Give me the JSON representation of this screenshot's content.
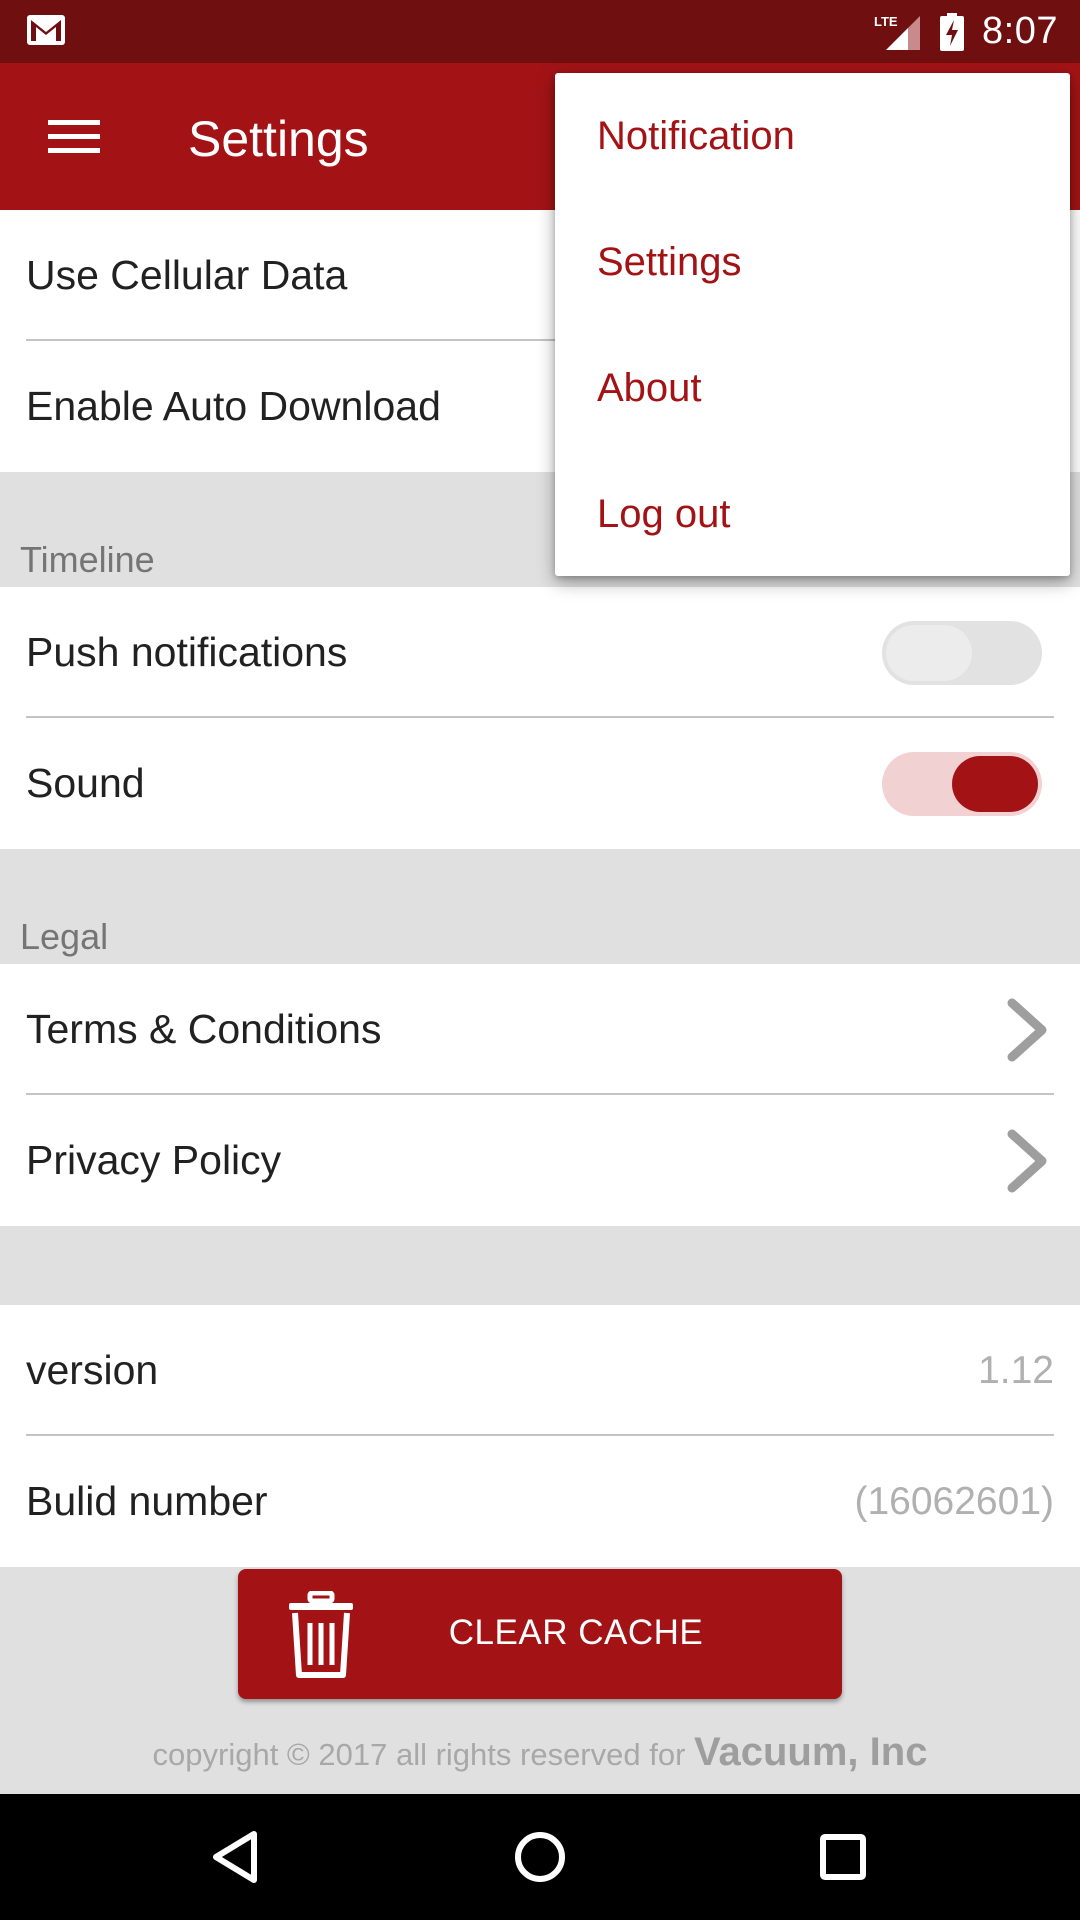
{
  "status_bar": {
    "time": "8:07",
    "network": "LTE",
    "icons": [
      "gmail-icon",
      "signal-icon",
      "battery-charging-icon"
    ]
  },
  "app_bar": {
    "title": "Settings",
    "menu_icon": "hamburger-menu-icon"
  },
  "settings": {
    "general": [
      {
        "label": "Use Cellular Data"
      },
      {
        "label": "Enable Auto Download"
      }
    ],
    "timeline": {
      "header": "Timeline",
      "items": [
        {
          "label": "Push notifications",
          "enabled": false
        },
        {
          "label": "Sound",
          "enabled": true
        }
      ]
    },
    "legal": {
      "header": "Legal",
      "items": [
        {
          "label": "Terms & Conditions"
        },
        {
          "label": "Privacy Policy"
        }
      ]
    },
    "info": [
      {
        "label": "version",
        "value": "1.12"
      },
      {
        "label": "Bulid number",
        "value": "(16062601)"
      }
    ]
  },
  "clear_cache": {
    "label": "CLEAR CACHE",
    "icon": "trash-icon"
  },
  "footer": {
    "copyright": "copyright © 2017 all rights reserved for",
    "company": "Vacuum, Inc"
  },
  "overflow_menu": {
    "items": [
      {
        "label": "Notification"
      },
      {
        "label": "Settings"
      },
      {
        "label": "About"
      },
      {
        "label": "Log out"
      }
    ]
  },
  "nav_bar": {
    "icons": [
      "back-icon",
      "home-icon",
      "recents-icon"
    ]
  },
  "colors": {
    "primary": "#a31316",
    "status_bar": "#6f0f10",
    "background": "#e0e0e0"
  }
}
